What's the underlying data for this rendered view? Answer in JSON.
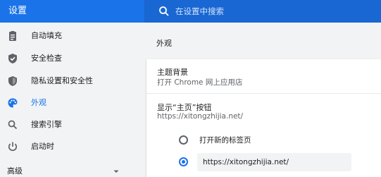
{
  "header": {
    "title": "设置",
    "search_placeholder": "在设置中搜索",
    "search_icon": "search-icon"
  },
  "sidebar": {
    "items": [
      {
        "label": "自动填充",
        "icon": "clipboard-icon"
      },
      {
        "label": "安全检查",
        "icon": "shield-check-icon"
      },
      {
        "label": "隐私设置和安全性",
        "icon": "shield-icon"
      },
      {
        "label": "外观",
        "icon": "palette-icon",
        "active": true
      },
      {
        "label": "搜索引擎",
        "icon": "search-icon"
      },
      {
        "label": "启动时",
        "icon": "power-icon"
      }
    ],
    "advanced_label": "高级"
  },
  "main": {
    "section_title": "外观",
    "theme": {
      "title": "主题背景",
      "subtitle": "打开 Chrome 网上应用店"
    },
    "home_button": {
      "title": "显示“主页”按钮",
      "subtitle": "https://xitongzhijia.net/",
      "options": [
        {
          "label": "打开新的标签页",
          "checked": false
        },
        {
          "label": "",
          "checked": true
        }
      ],
      "url_value": "https://xitongzhijia.net/"
    }
  },
  "colors": {
    "accent": "#1a73e8",
    "header_bg": "#1a73e8",
    "search_bg": "#1967d2"
  }
}
